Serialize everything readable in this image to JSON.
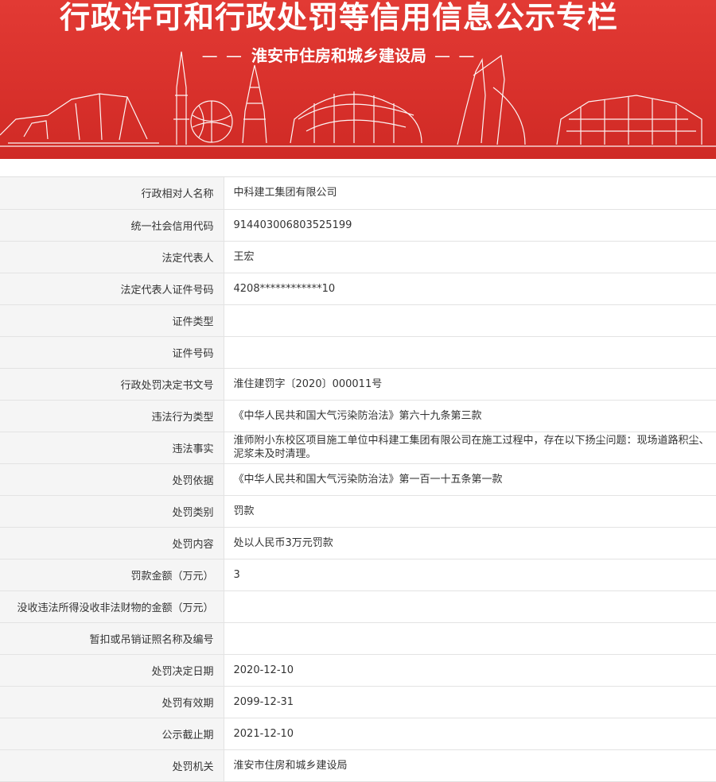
{
  "banner": {
    "title": "行政许可和行政处罚等信用信息公示专栏",
    "subtitle": "淮安市住房和城乡建设局",
    "dash_left": "— —",
    "dash_right": "— —"
  },
  "records": [
    {
      "label": "行政相对人名称",
      "value": "中科建工集团有限公司"
    },
    {
      "label": "统一社会信用代码",
      "value": "914403006803525199"
    },
    {
      "label": "法定代表人",
      "value": "王宏"
    },
    {
      "label": "法定代表人证件号码",
      "value": "4208************10"
    },
    {
      "label": "证件类型",
      "value": ""
    },
    {
      "label": "证件号码",
      "value": ""
    },
    {
      "label": "行政处罚决定书文号",
      "value": "淮住建罚字〔2020〕000011号"
    },
    {
      "label": "违法行为类型",
      "value": "《中华人民共和国大气污染防治法》第六十九条第三款"
    },
    {
      "label": "违法事实",
      "value": "淮师附小东校区项目施工单位中科建工集团有限公司在施工过程中，存在以下扬尘问题：现场道路积尘、泥浆未及时清理。"
    },
    {
      "label": "处罚依据",
      "value": "《中华人民共和国大气污染防治法》第一百一十五条第一款"
    },
    {
      "label": "处罚类别",
      "value": "罚款"
    },
    {
      "label": "处罚内容",
      "value": "处以人民币3万元罚款"
    },
    {
      "label": "罚款金额（万元）",
      "value": "3"
    },
    {
      "label": "没收违法所得没收非法财物的金额（万元）",
      "value": ""
    },
    {
      "label": "暂扣或吊销证照名称及编号",
      "value": ""
    },
    {
      "label": "处罚决定日期",
      "value": "2020-12-10"
    },
    {
      "label": "处罚有效期",
      "value": "2099-12-31"
    },
    {
      "label": "公示截止期",
      "value": "2021-12-10"
    },
    {
      "label": "处罚机关",
      "value": "淮安市住房和城乡建设局"
    }
  ]
}
